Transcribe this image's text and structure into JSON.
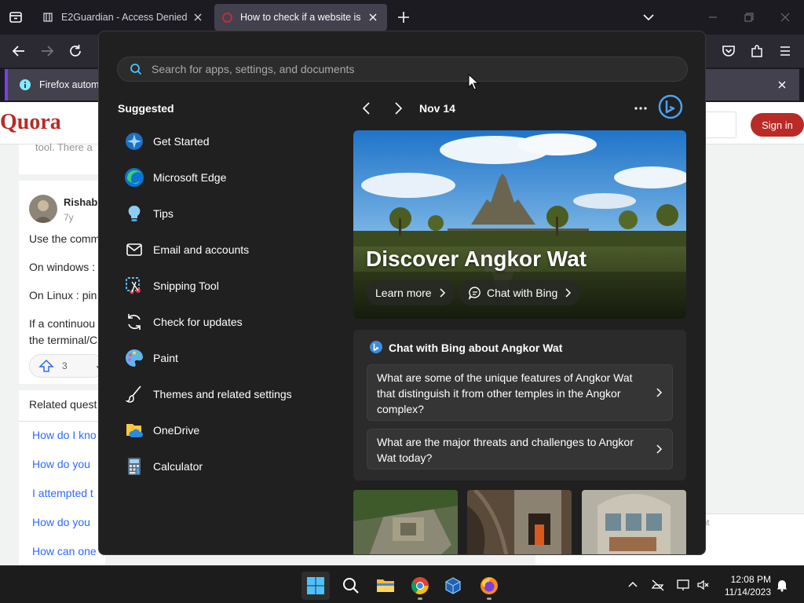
{
  "browser": {
    "tabs": [
      {
        "title": "E2Guardian - Access Denied"
      },
      {
        "title": "How to check if a website is blo"
      }
    ],
    "notification": "Firefox automa"
  },
  "quora": {
    "logo": "Quora",
    "signin": "Sign in",
    "snippet": "tool. There a",
    "author": "Rishabl",
    "time": "7y",
    "answer_lines": [
      "Use the comm",
      "On windows :",
      "On Linux : pin",
      "If a continuou",
      "the terminal/C"
    ],
    "upvotes": "3",
    "related_title": "Related quest",
    "related": [
      "How do I kno",
      "How do you",
      "I attempted t",
      "How do you",
      "How can one"
    ],
    "right_box_text": "nent"
  },
  "start_menu": {
    "search_placeholder": "Search for apps, settings, and documents",
    "suggested_title": "Suggested",
    "apps": [
      {
        "label": "Get Started",
        "icon": "get-started-icon"
      },
      {
        "label": "Microsoft Edge",
        "icon": "edge-icon"
      },
      {
        "label": "Tips",
        "icon": "tips-icon"
      },
      {
        "label": "Email and accounts",
        "icon": "mail-icon"
      },
      {
        "label": "Snipping Tool",
        "icon": "snipping-tool-icon"
      },
      {
        "label": "Check for updates",
        "icon": "update-icon"
      },
      {
        "label": "Paint",
        "icon": "paint-icon"
      },
      {
        "label": "Themes and related settings",
        "icon": "brush-icon"
      },
      {
        "label": "OneDrive",
        "icon": "onedrive-icon"
      },
      {
        "label": "Calculator",
        "icon": "calculator-icon"
      }
    ],
    "bing": {
      "date": "Nov 14",
      "hero_title": "Discover Angkor Wat",
      "learn_more": "Learn more",
      "chat_with_bing": "Chat with Bing",
      "chat_title": "Chat with Bing about Angkor Wat",
      "questions": [
        "What are some of the unique features of Angkor Wat that distinguish it from other temples in the Angkor complex?",
        "What are the major threats and challenges to Angkor Wat today?"
      ]
    }
  },
  "taskbar": {
    "time": "12:08 PM",
    "date": "11/14/2023"
  },
  "colors": {
    "start_bg": "#202020",
    "accent_blue": "#0078d4",
    "quora_red": "#b92b27",
    "firefox_tab": "#42414d"
  }
}
